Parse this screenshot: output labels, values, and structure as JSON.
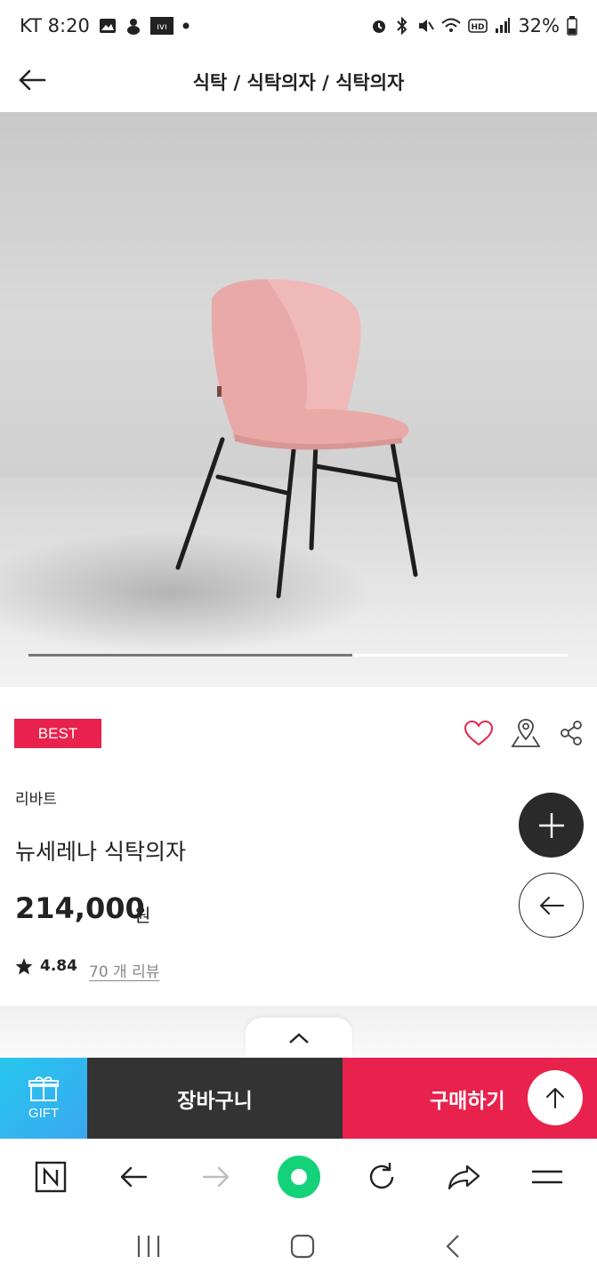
{
  "status_bar": {
    "carrier_time": "KT 8:20",
    "battery": "32%"
  },
  "header": {
    "breadcrumb": "식탁 / 식탁의자 / 식탁의자"
  },
  "hero": {
    "carousel_progress": 0.6
  },
  "product": {
    "badge": "BEST",
    "brand": "리바트",
    "name": "뉴세레나 식탁의자",
    "price": "214,000",
    "currency": "원",
    "rating": "4.84",
    "reviews": "70 개 리뷰"
  },
  "purchase_bar": {
    "gift_label": "GIFT",
    "cart_label": "장바구니",
    "buy_label": "구매하기"
  },
  "colors": {
    "accent": "#e8224d",
    "dark": "#333333",
    "gift": "#2fb8ef",
    "browser_green": "#14d27a"
  }
}
